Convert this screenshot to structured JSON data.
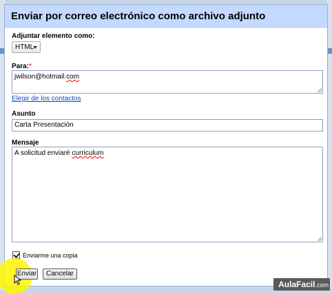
{
  "dialog": {
    "title": "Enviar por correo electrónico como archivo adjunto",
    "attach_label": "Adjuntar elemento como:",
    "format_selected": "HTML",
    "to_label": "Para:",
    "to_required_mark": "*",
    "to_value_prefix": "jwilson@hotmail.",
    "to_value_suffix": "com",
    "choose_contacts_link": "Elegir de los contactos",
    "subject_label": "Asunto",
    "subject_value": "Carta Presentación",
    "message_label": "Mensaje",
    "message_value_prefix": "A solicitud enviaré ",
    "message_value_spell": "curriculum",
    "send_copy_label": "Enviarme una copia",
    "send_copy_checked": true,
    "send_button": "Enviar",
    "cancel_button": "Cancelar"
  },
  "watermark": {
    "brand": "AulaFacil",
    "suffix": ".com"
  },
  "colors": {
    "titlebar": "#c3d9ff",
    "link": "#0e47c2",
    "required": "#cc0000",
    "highlight": "#fff500"
  }
}
